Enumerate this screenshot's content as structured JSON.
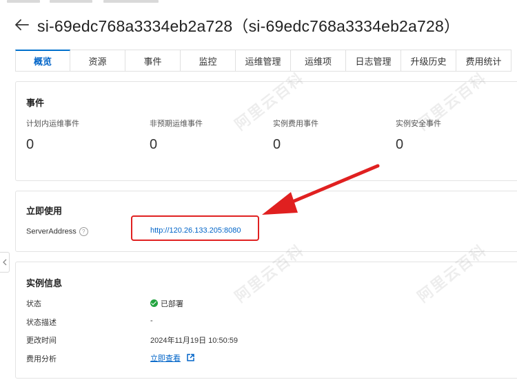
{
  "header": {
    "title": "si-69edc768a3334eb2a728（si-69edc768a3334eb2a728）"
  },
  "tabs": [
    {
      "label": "概览"
    },
    {
      "label": "资源"
    },
    {
      "label": "事件"
    },
    {
      "label": "监控"
    },
    {
      "label": "运维管理"
    },
    {
      "label": "运维项"
    },
    {
      "label": "日志管理"
    },
    {
      "label": "升级历史"
    },
    {
      "label": "费用统计"
    }
  ],
  "events": {
    "title": "事件",
    "items": [
      {
        "label": "计划内运维事件",
        "value": "0"
      },
      {
        "label": "非预期运维事件",
        "value": "0"
      },
      {
        "label": "实例费用事件",
        "value": "0"
      },
      {
        "label": "实例安全事件",
        "value": "0"
      }
    ]
  },
  "quick_use": {
    "title": "立即使用",
    "server_label": "ServerAddress",
    "server_value": "http://120.26.133.205:8080"
  },
  "instance_info": {
    "title": "实例信息",
    "status_label": "状态",
    "status_value": "已部署",
    "desc_label": "状态描述",
    "desc_value": "-",
    "updated_label": "更改时间",
    "updated_value": "2024年11月19日 10:50:59",
    "cost_label": "费用分析",
    "cost_link": "立即查看"
  },
  "watermark": "阿里云百科",
  "colors": {
    "accent": "#0064c8",
    "annotation": "#e02020",
    "success": "#23a440"
  }
}
